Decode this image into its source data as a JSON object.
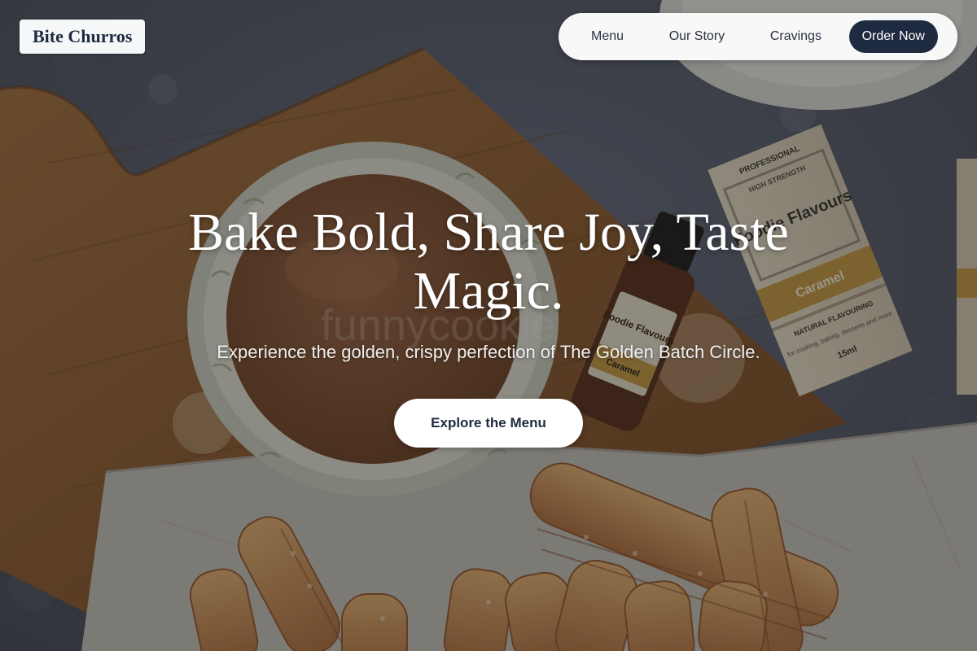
{
  "brand": {
    "logo_text": "Bite Churros"
  },
  "nav": {
    "items": [
      {
        "label": "Menu"
      },
      {
        "label": "Our Story"
      },
      {
        "label": "Cravings"
      }
    ],
    "cta_label": "Order Now"
  },
  "hero": {
    "headline": "Bake Bold, Share Joy, Taste Magic.",
    "subtitle": "Experience the golden, crispy perfection of The Golden Batch Circle.",
    "cta_label": "Explore the Menu",
    "background_image": "churros-caramel-dip-photo",
    "image_text": {
      "bottle_brand": "Foodie Flavours",
      "bottle_flavour": "Caramel",
      "box_top": "PROFESSIONAL",
      "box_strength": "HIGH STRENGTH",
      "box_brand": "Foodie Flavours",
      "box_flavour": "Caramel",
      "box_type": "NATURAL FLAVOURING",
      "box_use": "for cooking, baking, desserts and more",
      "box_size": "15ml",
      "watermark": "funnycookie"
    }
  },
  "colors": {
    "brand_navy": "#1e2a3f",
    "nav_background": "#f8f8f8",
    "cta_background": "#ffffff",
    "logo_background": "#f6f7f9"
  }
}
